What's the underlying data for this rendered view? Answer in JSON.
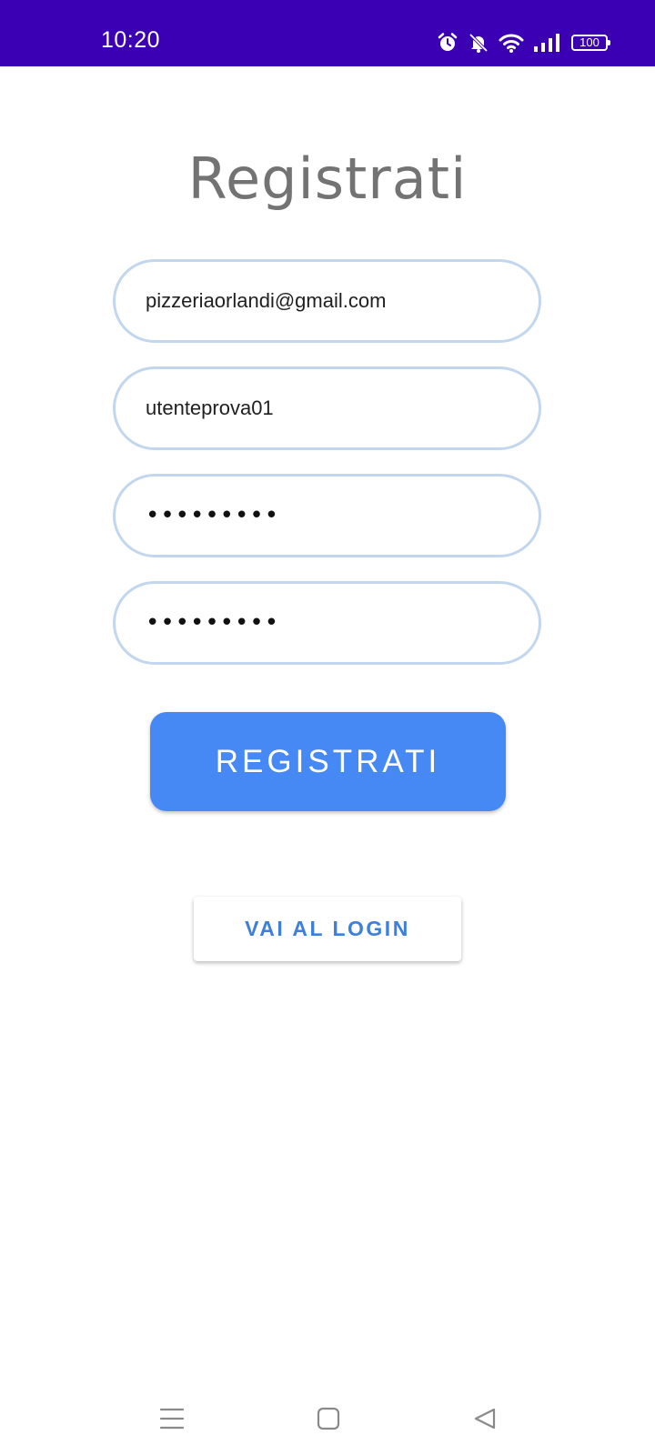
{
  "status_bar": {
    "time": "10:20",
    "battery": "100",
    "background": "#3b00b3",
    "icons": [
      "alarm-icon",
      "bell-muted-icon",
      "wifi-icon",
      "signal-icon",
      "battery-icon"
    ]
  },
  "title": "Registrati",
  "form": {
    "email": "pizzeriaorlandi@gmail.com",
    "username": "utenteprova01",
    "password": "•••••••••",
    "confirm_password": "•••••••••",
    "border_color": "#c3d6ef"
  },
  "register_button": {
    "label": "REGISTRATI",
    "color": "#4689f5"
  },
  "login_button": {
    "label": "VAI AL LOGIN",
    "color": "#3d7fdb"
  },
  "nav_bar": {
    "icons": [
      "menu-icon",
      "home-icon",
      "back-icon"
    ]
  }
}
